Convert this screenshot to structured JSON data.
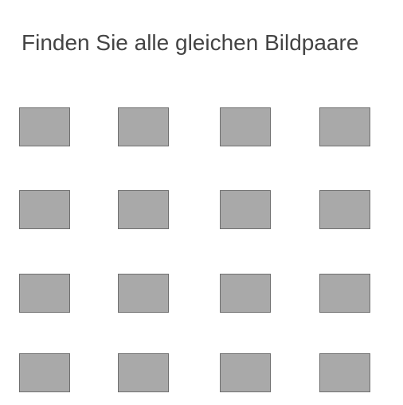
{
  "game": {
    "title": "Finden Sie alle gleichen Bildpaare",
    "rows": 4,
    "columns": 4,
    "card_face": "hidden",
    "card_color": "#a9a9a9"
  }
}
